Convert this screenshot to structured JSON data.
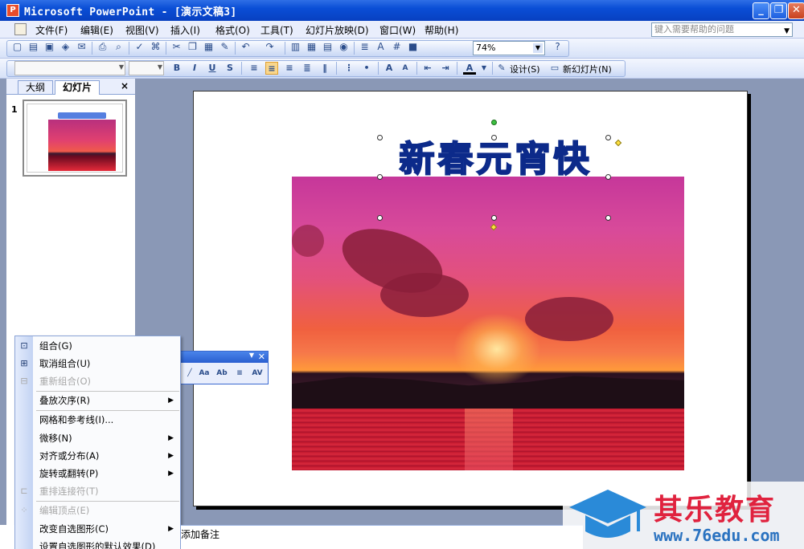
{
  "window": {
    "title": "Microsoft PowerPoint - [演示文稿3]",
    "app_icon_letter": "P"
  },
  "menubar": {
    "items": [
      "文件(F)",
      "编辑(E)",
      "视图(V)",
      "插入(I)",
      "格式(O)",
      "工具(T)",
      "幻灯片放映(D)",
      "窗口(W)",
      "帮助(H)"
    ],
    "help_placeholder": "键入需要帮助的问题"
  },
  "standard_toolbar": {
    "zoom": "74%"
  },
  "formatting_toolbar": {
    "design_label": "设计(S)",
    "new_slide_label": "新幻灯片(N)"
  },
  "left_pane": {
    "tabs": [
      "大纲",
      "幻灯片"
    ],
    "close": "×",
    "slide_number": "1"
  },
  "slide": {
    "wordart_text": "新春元宵快乐"
  },
  "wordart_toolbar": {
    "buttons": [
      "Aa",
      "Ab",
      "≡",
      "AV"
    ]
  },
  "context_menu": {
    "items": [
      {
        "label": "组合(G)",
        "enabled": true,
        "submenu": false
      },
      {
        "label": "取消组合(U)",
        "enabled": true,
        "submenu": false
      },
      {
        "label": "重新组合(O)",
        "enabled": false,
        "submenu": false
      },
      {
        "label": "叠放次序(R)",
        "enabled": true,
        "submenu": true
      },
      {
        "label": "网格和参考线(I)...",
        "enabled": true,
        "submenu": false
      },
      {
        "label": "微移(N)",
        "enabled": true,
        "submenu": true
      },
      {
        "label": "对齐或分布(A)",
        "enabled": true,
        "submenu": true
      },
      {
        "label": "旋转或翻转(P)",
        "enabled": true,
        "submenu": true
      },
      {
        "label": "重排连接符(T)",
        "enabled": false,
        "submenu": false
      },
      {
        "label": "编辑顶点(E)",
        "enabled": false,
        "submenu": false
      },
      {
        "label": "改变自选图形(C)",
        "enabled": true,
        "submenu": true
      },
      {
        "label": "设置自选图形的默认效果(D)",
        "enabled": true,
        "submenu": false
      }
    ]
  },
  "notes": {
    "placeholder": "添加备注"
  },
  "watermark": {
    "brand": "其乐教育",
    "url": "www.76edu.com"
  },
  "colors": {
    "title_bar": "#0a4ed6",
    "wordart": "#2a5fd8",
    "brand_red": "#e0223e",
    "brand_blue": "#2a72c0"
  }
}
